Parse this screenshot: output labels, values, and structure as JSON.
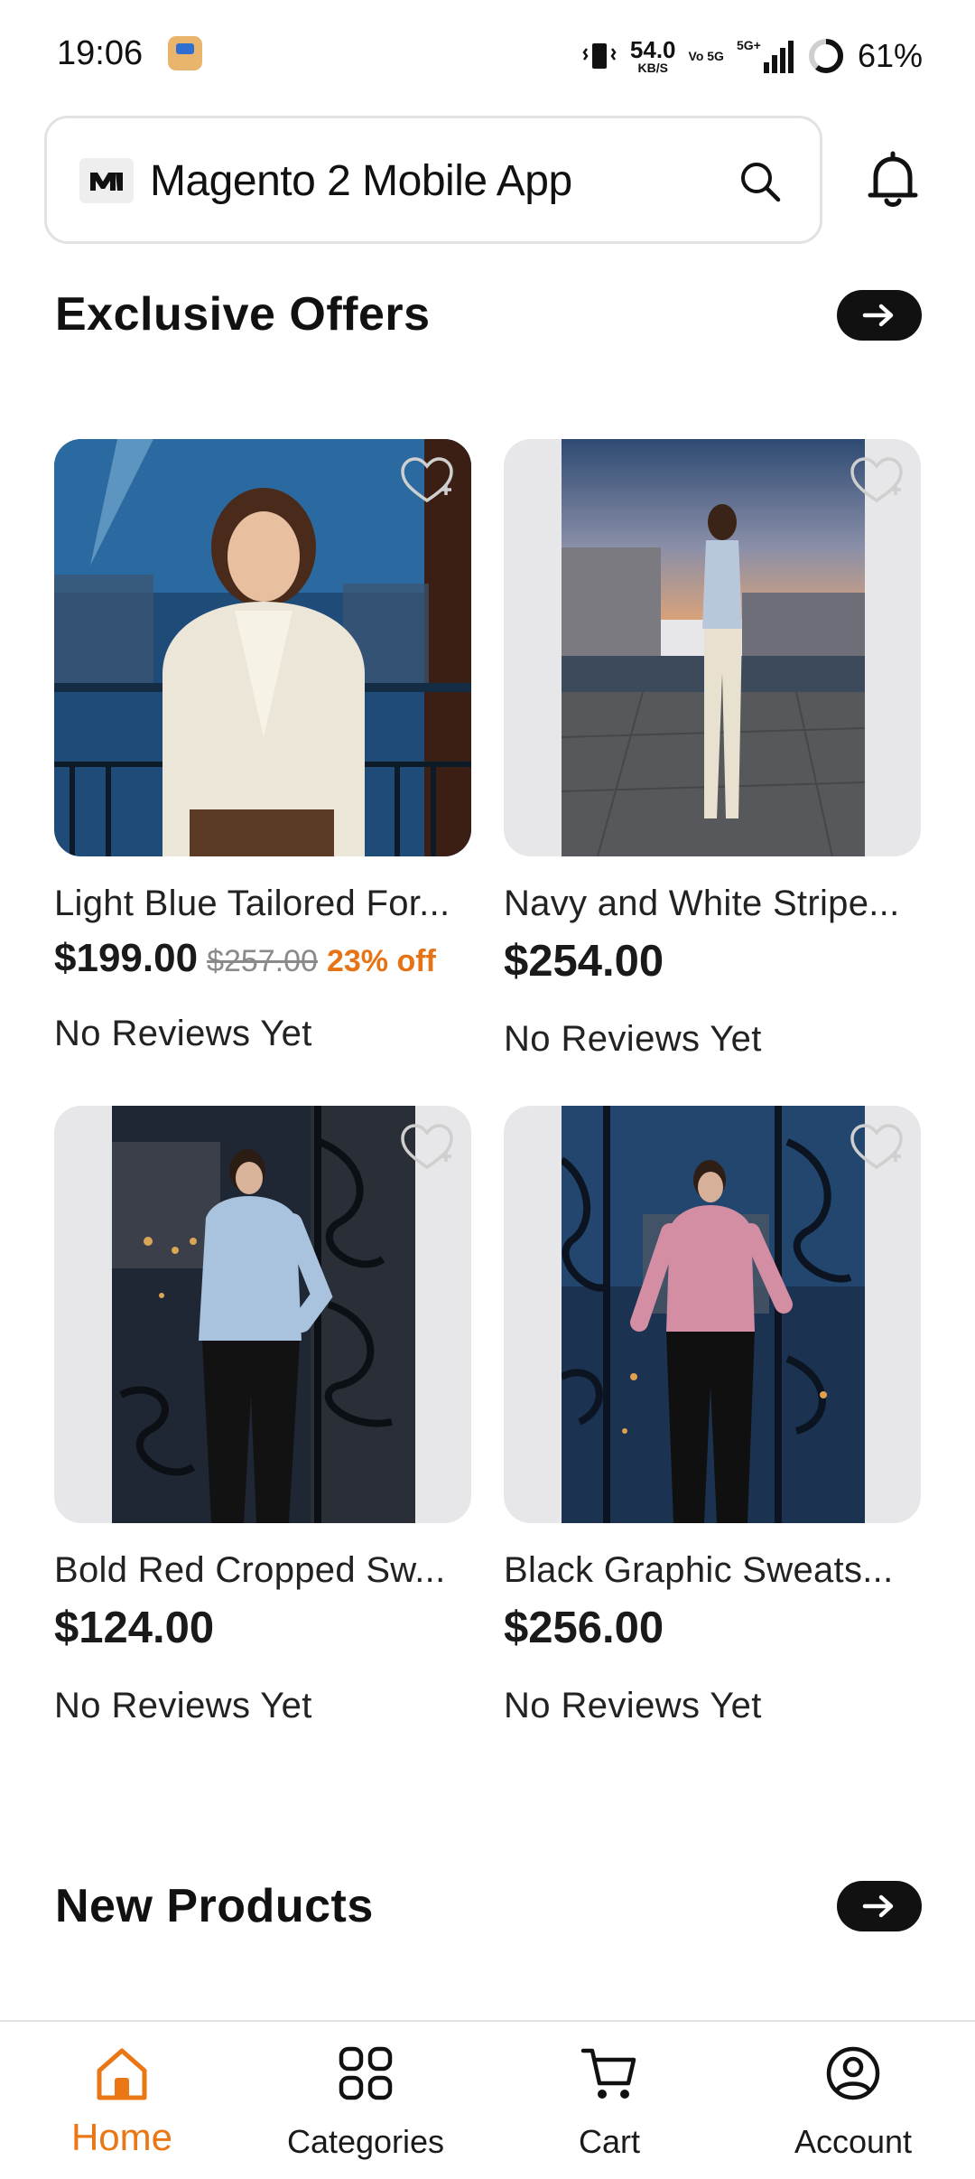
{
  "status_bar": {
    "time": "19:06",
    "net_speed_value": "54.0",
    "net_speed_unit": "KB/S",
    "volte": "Vo 5G",
    "battery": "61%"
  },
  "header": {
    "search_title": "Magento 2 Mobile App",
    "icons": [
      "brand-logo",
      "search-icon",
      "bell-icon"
    ]
  },
  "sections": {
    "exclusive_offers": {
      "title": "Exclusive Offers"
    },
    "new_products": {
      "title": "New Products"
    }
  },
  "products": [
    {
      "name": "Light Blue Tailored For...",
      "price": "$199.00",
      "old_price": "$257.00",
      "discount": "23% off",
      "reviews": "No Reviews Yet"
    },
    {
      "name": "Navy and White Stripe...",
      "price": "$254.00",
      "reviews": "No Reviews Yet"
    },
    {
      "name": "Bold Red Cropped Sw...",
      "price": "$124.00",
      "reviews": "No Reviews Yet"
    },
    {
      "name": "Black Graphic Sweats...",
      "price": "$256.00",
      "reviews": "No Reviews Yet"
    }
  ],
  "bottom_nav": {
    "items": [
      {
        "label": "Home",
        "icon": "home-icon",
        "active": true
      },
      {
        "label": "Categories",
        "icon": "grid-icon",
        "active": false
      },
      {
        "label": "Cart",
        "icon": "cart-icon",
        "active": false
      },
      {
        "label": "Account",
        "icon": "account-icon",
        "active": false
      }
    ]
  },
  "colors": {
    "accent": "#ea7614",
    "discount": "#e67416",
    "card_background": "#e7e7ea",
    "pill": "#111111"
  }
}
